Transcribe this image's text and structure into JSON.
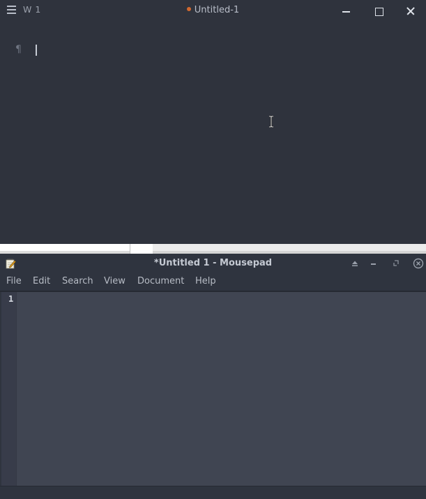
{
  "top_window": {
    "word_count": "W 1",
    "title": "Untitled-1",
    "unsaved_dot_color": "#d2692f",
    "pilcrow": "¶",
    "icons": [
      "menu-icon",
      "minimize-icon",
      "maximize-icon",
      "close-icon",
      "pilcrow-icon",
      "text-cursor-icon"
    ]
  },
  "mousepad": {
    "title": "*Untitled 1 - Mousepad",
    "menu": {
      "file": "File",
      "edit": "Edit",
      "search": "Search",
      "view": "View",
      "document": "Document",
      "help": "Help"
    },
    "line_number": "1",
    "icons": [
      "mousepad-app-icon",
      "shade-icon",
      "minimize-icon",
      "maximize-icon",
      "close-icon"
    ]
  }
}
